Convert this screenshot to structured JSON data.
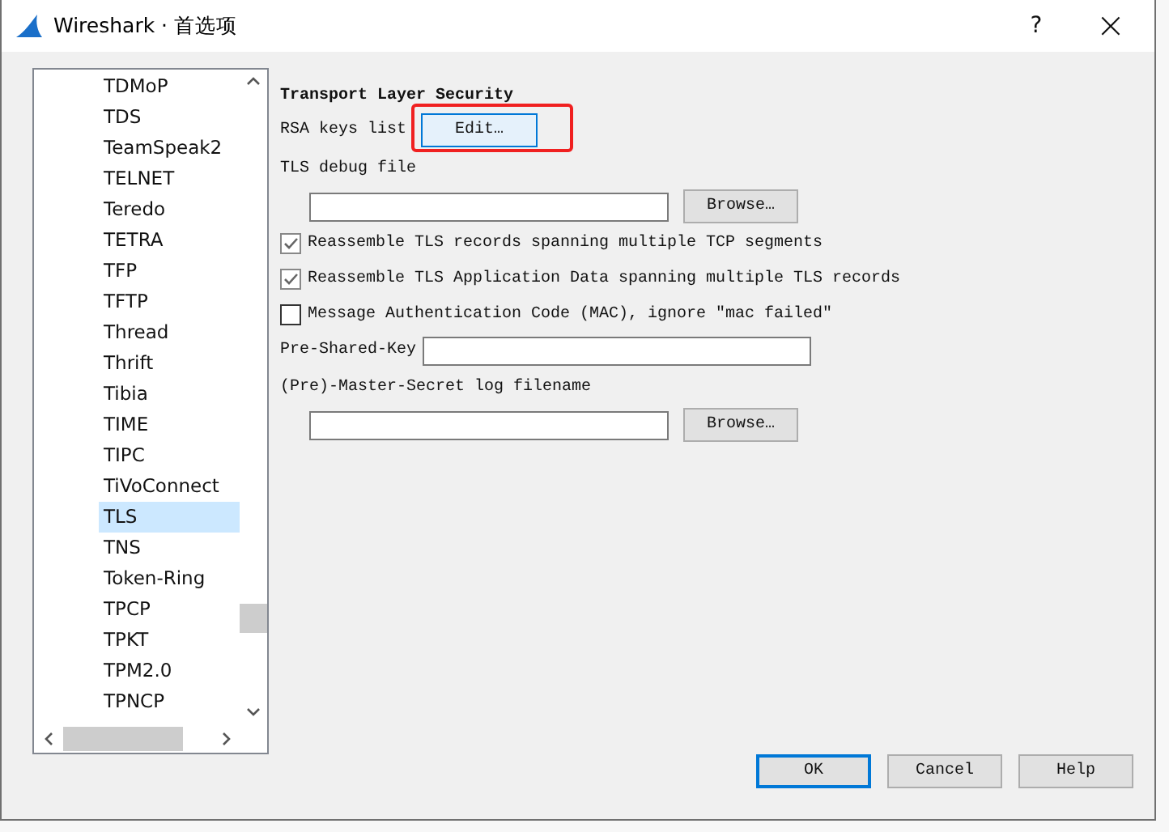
{
  "window": {
    "title": "Wireshark · 首选项",
    "help_button": "?",
    "close_button": "×"
  },
  "protocols": [
    {
      "label": "TDMoP",
      "selected": false
    },
    {
      "label": "TDS",
      "selected": false
    },
    {
      "label": "TeamSpeak2",
      "selected": false
    },
    {
      "label": "TELNET",
      "selected": false
    },
    {
      "label": "Teredo",
      "selected": false
    },
    {
      "label": "TETRA",
      "selected": false
    },
    {
      "label": "TFP",
      "selected": false
    },
    {
      "label": "TFTP",
      "selected": false
    },
    {
      "label": "Thread",
      "selected": false
    },
    {
      "label": "Thrift",
      "selected": false
    },
    {
      "label": "Tibia",
      "selected": false
    },
    {
      "label": "TIME",
      "selected": false
    },
    {
      "label": "TIPC",
      "selected": false
    },
    {
      "label": "TiVoConnect",
      "selected": false
    },
    {
      "label": "TLS",
      "selected": true
    },
    {
      "label": "TNS",
      "selected": false
    },
    {
      "label": "Token-Ring",
      "selected": false
    },
    {
      "label": "TPCP",
      "selected": false
    },
    {
      "label": "TPKT",
      "selected": false
    },
    {
      "label": "TPM2.0",
      "selected": false
    },
    {
      "label": "TPNCP",
      "selected": false
    }
  ],
  "panel": {
    "heading": "Transport Layer Security",
    "rsa_keys": {
      "label": "RSA keys list",
      "button": "Edit…",
      "highlighted": true
    },
    "debug_file": {
      "label": "TLS debug file",
      "button": "Browse…"
    },
    "options": [
      {
        "label": "Reassemble TLS records spanning multiple TCP segments",
        "checked": true
      },
      {
        "label": "Reassemble TLS Application Data spanning multiple TLS records",
        "checked": true
      },
      {
        "label": "Message Authentication Code (MAC), ignore \"mac failed\"",
        "checked": false
      }
    ],
    "psk": {
      "label": "Pre-Shared-Key"
    },
    "keylog": {
      "label": "(Pre)-Master-Secret log filename",
      "button": "Browse…"
    }
  },
  "buttons": [
    {
      "label": "OK",
      "default": true
    },
    {
      "label": "Cancel",
      "default": false
    },
    {
      "label": "Help",
      "default": false
    }
  ]
}
